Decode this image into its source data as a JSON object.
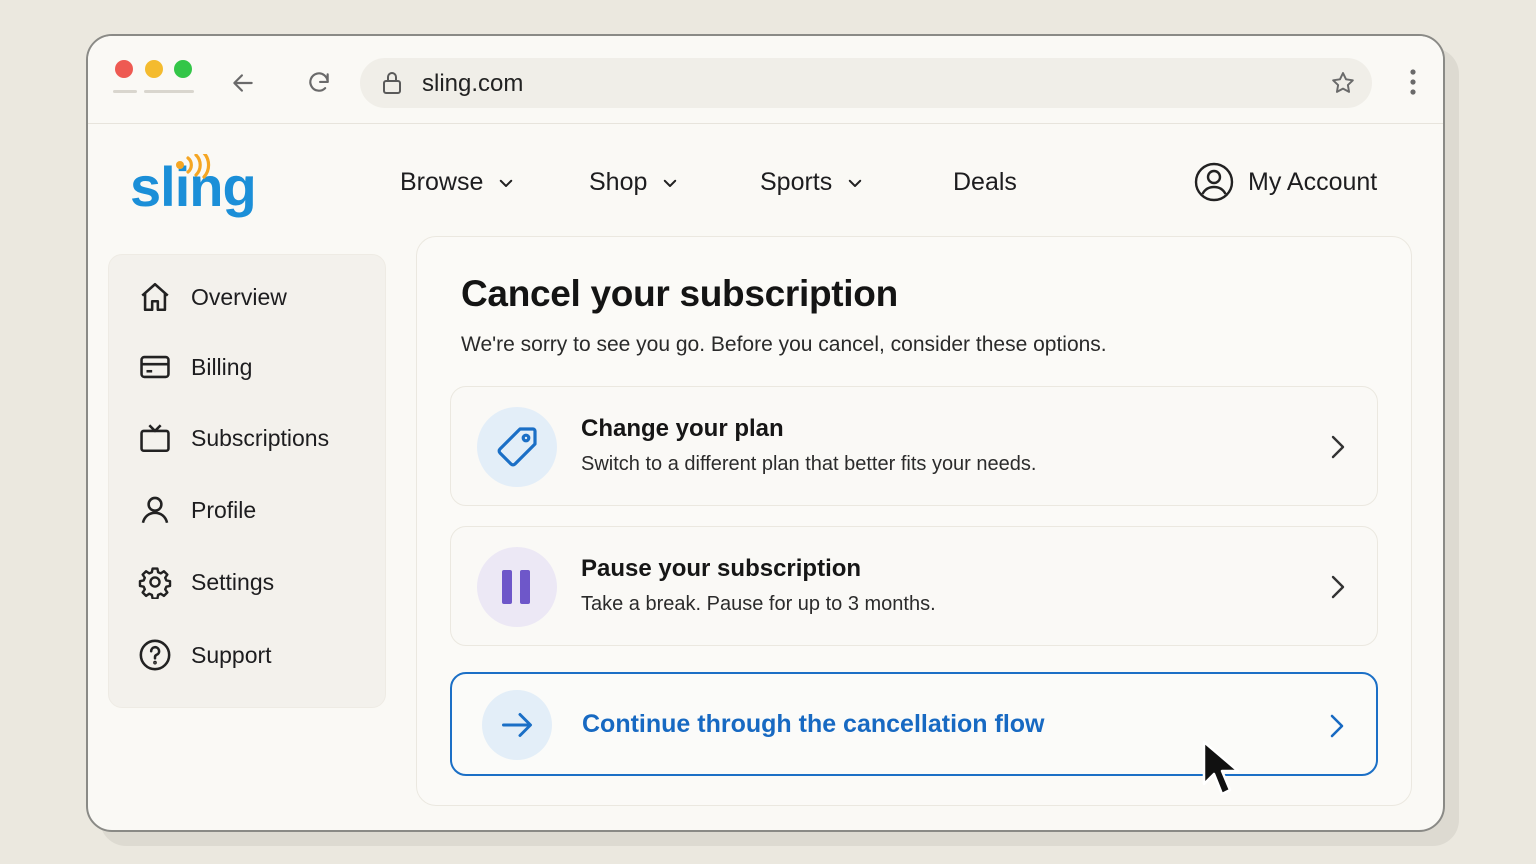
{
  "browser": {
    "url": "sling.com",
    "icons": [
      "back-arrow-icon",
      "reload-icon",
      "lock-icon",
      "star-icon",
      "kebab-menu-icon"
    ]
  },
  "header": {
    "logo_text": "sling",
    "nav": [
      {
        "label": "Browse",
        "has_dropdown": true
      },
      {
        "label": "Shop",
        "has_dropdown": true
      },
      {
        "label": "Sports",
        "has_dropdown": true
      },
      {
        "label": "Deals",
        "has_dropdown": false
      }
    ],
    "account_label": "My Account"
  },
  "sidebar": {
    "items": [
      {
        "label": "Overview",
        "icon": "home-icon"
      },
      {
        "label": "Billing",
        "icon": "credit-card-icon"
      },
      {
        "label": "Subscriptions",
        "icon": "tv-icon"
      },
      {
        "label": "Profile",
        "icon": "user-icon"
      },
      {
        "label": "Settings",
        "icon": "gear-icon"
      },
      {
        "label": "Support",
        "icon": "help-circle-icon"
      }
    ]
  },
  "main": {
    "title": "Cancel your subscription",
    "subtitle": "We're sorry to see you go. Before you cancel, consider these options.",
    "options": [
      {
        "title": "Change your plan",
        "description": "Switch to a different plan that better fits your needs.",
        "icon": "tag-icon"
      },
      {
        "title": "Pause your subscription",
        "description": "Take a break. Pause for up to 3 months.",
        "icon": "pause-icon"
      }
    ],
    "continue_label": "Continue through the cancellation flow"
  },
  "colors": {
    "brand_blue": "#1b8fd8",
    "brand_orange": "#f5a623",
    "link_blue": "#1769c2",
    "pause_purple": "#6e57c9"
  }
}
